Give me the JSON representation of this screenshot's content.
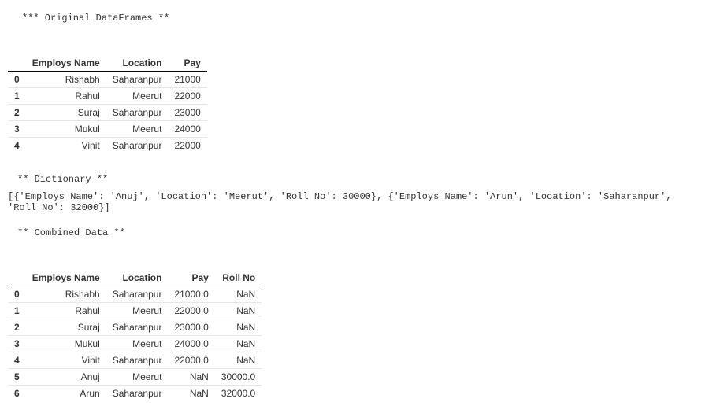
{
  "headings": {
    "original": "  ***  Original DataFrames  **",
    "dictionary": "  **  Dictionary  **",
    "combined": "  **  Combined Data  **"
  },
  "dict_text": "[{'Employs Name': 'Anuj', 'Location': 'Meerut', 'Roll No': 30000}, {'Employs Name': 'Arun', 'Location': 'Saharanpur', 'Roll No': 32000}]",
  "table1": {
    "columns": [
      "",
      "Employs Name",
      "Location",
      "Pay"
    ],
    "rows": [
      [
        "0",
        "Rishabh",
        "Saharanpur",
        "21000"
      ],
      [
        "1",
        "Rahul",
        "Meerut",
        "22000"
      ],
      [
        "2",
        "Suraj",
        "Saharanpur",
        "23000"
      ],
      [
        "3",
        "Mukul",
        "Meerut",
        "24000"
      ],
      [
        "4",
        "Vinit",
        "Saharanpur",
        "22000"
      ]
    ]
  },
  "table2": {
    "columns": [
      "",
      "Employs Name",
      "Location",
      "Pay",
      "Roll No"
    ],
    "rows": [
      [
        "0",
        "Rishabh",
        "Saharanpur",
        "21000.0",
        "NaN"
      ],
      [
        "1",
        "Rahul",
        "Meerut",
        "22000.0",
        "NaN"
      ],
      [
        "2",
        "Suraj",
        "Saharanpur",
        "23000.0",
        "NaN"
      ],
      [
        "3",
        "Mukul",
        "Meerut",
        "24000.0",
        "NaN"
      ],
      [
        "4",
        "Vinit",
        "Saharanpur",
        "22000.0",
        "NaN"
      ],
      [
        "5",
        "Anuj",
        "Meerut",
        "NaN",
        "30000.0"
      ],
      [
        "6",
        "Arun",
        "Saharanpur",
        "NaN",
        "32000.0"
      ]
    ]
  }
}
